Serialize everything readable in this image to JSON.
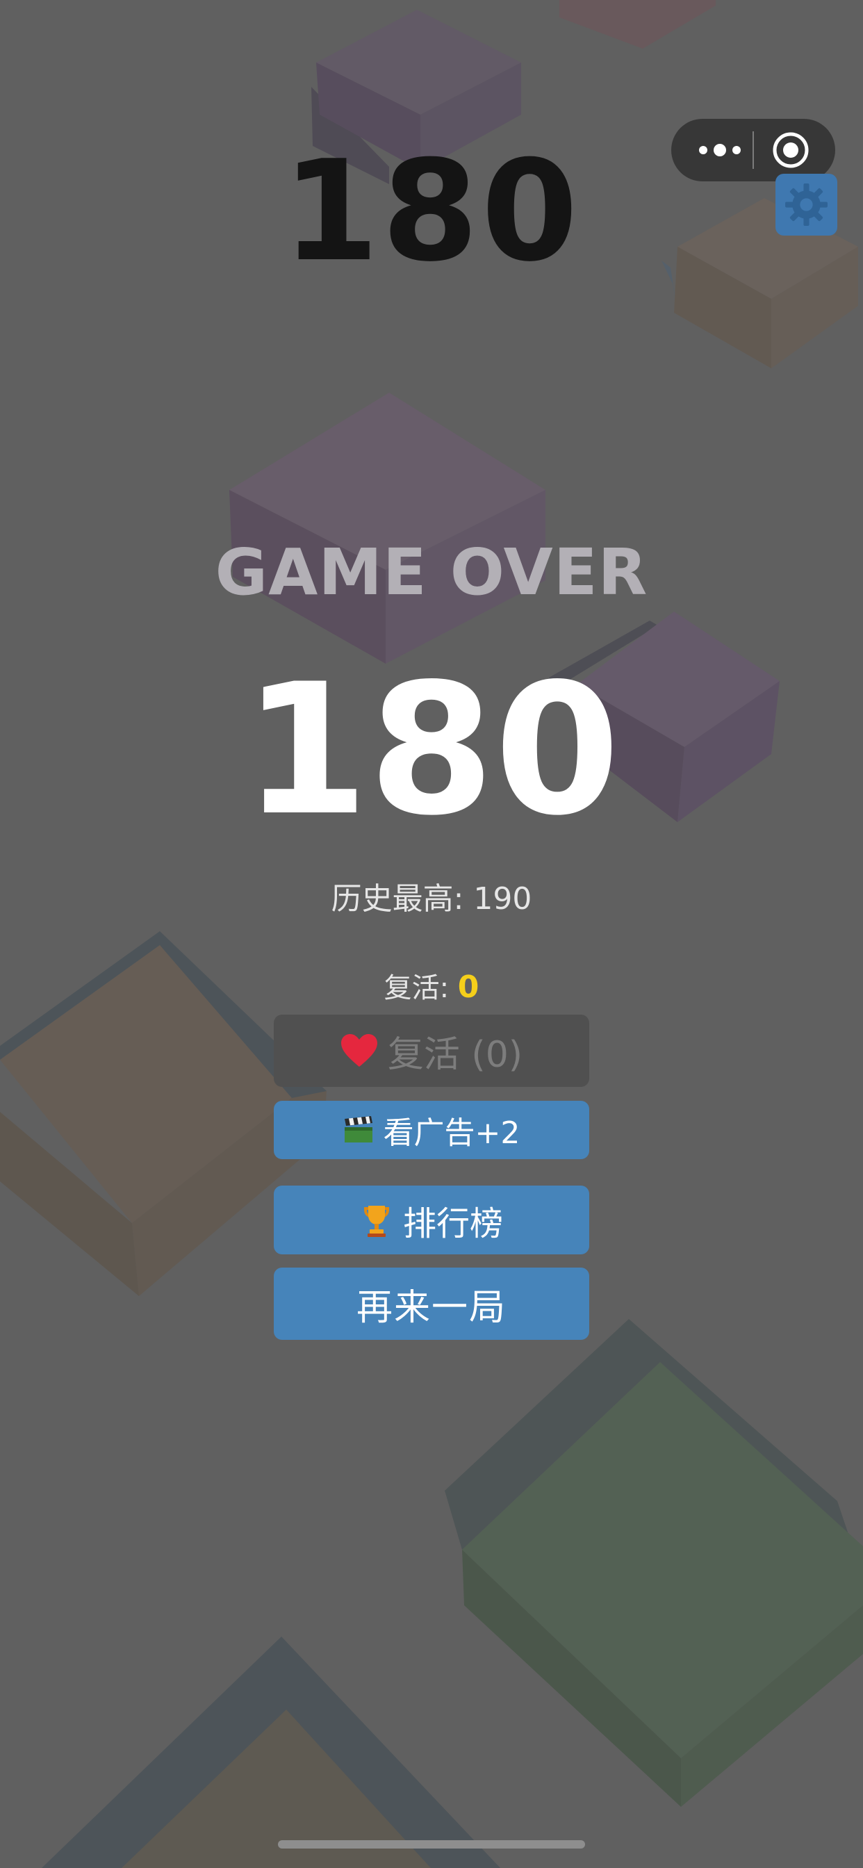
{
  "game": {
    "current_score": "180",
    "title": "GAME OVER",
    "final_score": "180",
    "best_score_text": "历史最高: 190",
    "revive_label": "复活:",
    "revive_count": "0"
  },
  "buttons": {
    "revive_label": "复活 (0)",
    "watch_ad_label": "看广告+2",
    "leaderboard_label": "排行榜",
    "play_again_label": "再来一局"
  },
  "icons": {
    "more": "more-dots-icon",
    "close": "target-circle-icon",
    "settings": "gear-icon",
    "heart": "heart-icon",
    "clapper": "clapperboard-icon",
    "trophy": "trophy-icon"
  },
  "colors": {
    "background": "#606060",
    "button_blue": "#4684ba",
    "button_disabled": "#505050",
    "revive_count": "#f5cf1a",
    "heart": "#e5273e",
    "trophy": "#f2a41c"
  }
}
